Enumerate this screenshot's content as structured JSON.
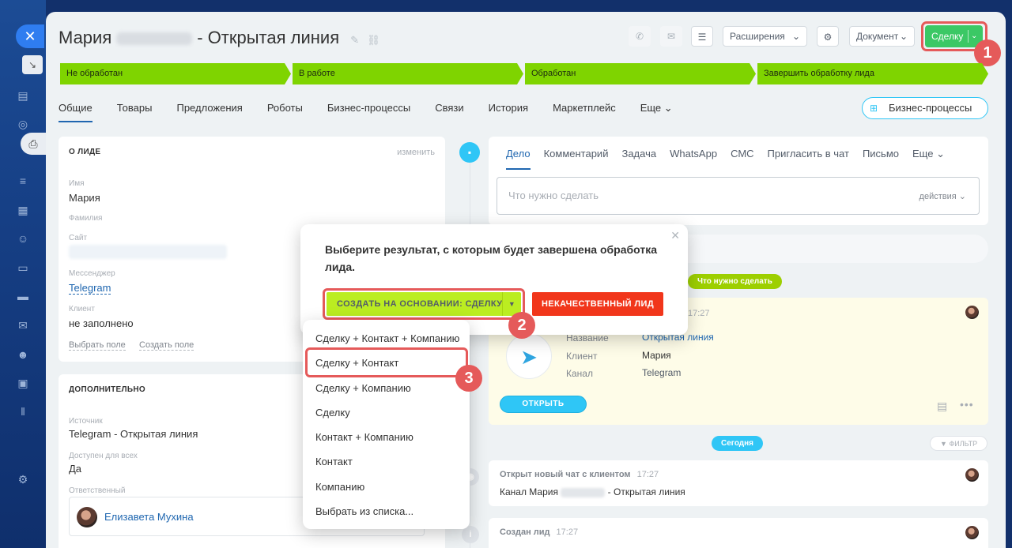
{
  "header": {
    "title_first": "Мария",
    "title_suffix": "- Открытая линия",
    "extensions_label": "Расширения",
    "document_label": "Документ",
    "deal_label": "Сделку"
  },
  "badges": [
    "1",
    "2",
    "3"
  ],
  "stages": [
    "Не обработан",
    "В работе",
    "Обработан",
    "Завершить обработку лида"
  ],
  "tabs": [
    "Общие",
    "Товары",
    "Предложения",
    "Роботы",
    "Бизнес-процессы",
    "Связи",
    "История",
    "Маркетплейс",
    "Еще"
  ],
  "bp_button": "Бизнес-процессы",
  "about": {
    "heading": "О ЛИДЕ",
    "edit": "изменить",
    "name_label": "Имя",
    "name_value": "Мария",
    "surname_label": "Фамилия",
    "site_label": "Сайт",
    "messenger_label": "Мессенджер",
    "messenger_value": "Telegram",
    "client_label": "Клиент",
    "client_value": "не заполнено",
    "choose_field": "Выбрать поле",
    "create_field": "Создать поле"
  },
  "additional": {
    "heading": "ДОПОЛНИТЕЛЬНО",
    "source_label": "Источник",
    "source_value": "Telegram - Открытая линия",
    "public_label": "Доступен для всех",
    "public_value": "Да",
    "responsible_label": "Ответственный",
    "responsible_value": "Елизавета Мухина"
  },
  "editor": {
    "tabs": [
      "Дело",
      "Комментарий",
      "Задача",
      "WhatsApp",
      "СМС",
      "Пригласить в чат",
      "Письмо",
      "Еще"
    ],
    "placeholder": "Что нужно сделать",
    "actions": "действия"
  },
  "pills": {
    "todo": "Что нужно сделать",
    "today": "Сегодня",
    "filter": "ФИЛЬТР"
  },
  "todo_card": {
    "time": "17:27",
    "name_label": "Название",
    "name_value": "Открытая линия",
    "client_label": "Клиент",
    "client_value": "Мария",
    "channel_label": "Канал",
    "channel_value": "Telegram",
    "open_button": "ОТКРЫТЬ"
  },
  "feed": [
    {
      "title": "Открыт новый чат с клиентом",
      "time": "17:27",
      "text_prefix": "Канал Мария",
      "text_suffix": "- Открытая линия"
    },
    {
      "title": "Создан лид",
      "time": "17:27"
    }
  ],
  "popup": {
    "message": "Выберите результат, с которым будет завершена обработка лида.",
    "create_button": "СОЗДАТЬ НА ОСНОВАНИИ: СДЕЛКУ",
    "bad_button": "НЕКАЧЕСТВЕННЫЙ ЛИД",
    "menu": [
      "Сделку + Контакт + Компанию",
      "Сделку + Контакт",
      "Сделку + Компанию",
      "Сделку",
      "Контакт + Компанию",
      "Контакт",
      "Компанию",
      "Выбрать из списка..."
    ]
  }
}
